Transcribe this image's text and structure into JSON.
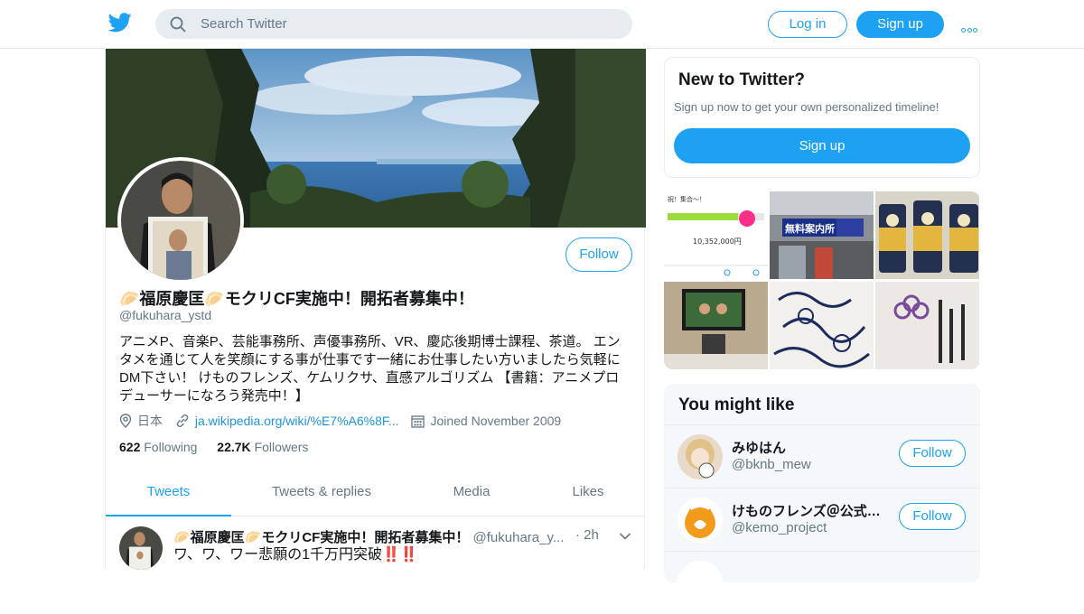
{
  "search": {
    "placeholder": "Search Twitter"
  },
  "header": {
    "login_label": "Log in",
    "signup_label": "Sign up"
  },
  "profile": {
    "follow_label": "Follow",
    "display_name": "🥟福原慶匡🥟モクリCF実施中！開拓者募集中！",
    "handle": "@fukuhara_ystd",
    "bio": "アニメP、音楽P、芸能事務所、声優事務所、VR、慶応後期博士課程、茶道。 エンタメを通じて人を笑顔にする事が仕事です一緒にお仕事したい方いましたら気軽にDM下さい！ けものフレンズ、ケムリクサ、直感アルゴリズム 【書籍：アニメプロデューサーになろう発売中！】",
    "location": "日本",
    "url": "ja.wikipedia.org/wiki/%E7%A6%8F...",
    "joined": "Joined November 2009",
    "following_count": "622",
    "following_label": "Following",
    "followers_count": "22.7K",
    "followers_label": "Followers"
  },
  "tabs": [
    "Tweets",
    "Tweets & replies",
    "Media",
    "Likes"
  ],
  "tweet": {
    "name": "🥟福原慶匡🥟モクリCF実施中！開拓者募集中！",
    "handle": "@fukuhara_y...",
    "time": "· 2h",
    "text": "ワ、ワ、ワー悲願の1千万円突破",
    "bangs": "‼️‼️"
  },
  "new_to_twitter": {
    "title": "New to Twitter?",
    "subtitle": "Sign up now to get your own personalized timeline!",
    "signup_label": "Sign up"
  },
  "media_thumbs": {
    "t1_title": "祝！集合〜！",
    "t1_amount": "10,352,000円",
    "t2_sign": "無料案内所"
  },
  "you_might_like": {
    "title": "You might like",
    "accounts": [
      {
        "name": "みゆはん",
        "handle": "@bknb_mew",
        "follow_label": "Follow"
      },
      {
        "name": "けものフレンズ＠公式…",
        "handle": "@kemo_project",
        "follow_label": "Follow"
      }
    ]
  },
  "colors": {
    "accent": "#1da1f2",
    "text": "#14171a",
    "muted": "#657786",
    "border": "#e6ecf0"
  }
}
